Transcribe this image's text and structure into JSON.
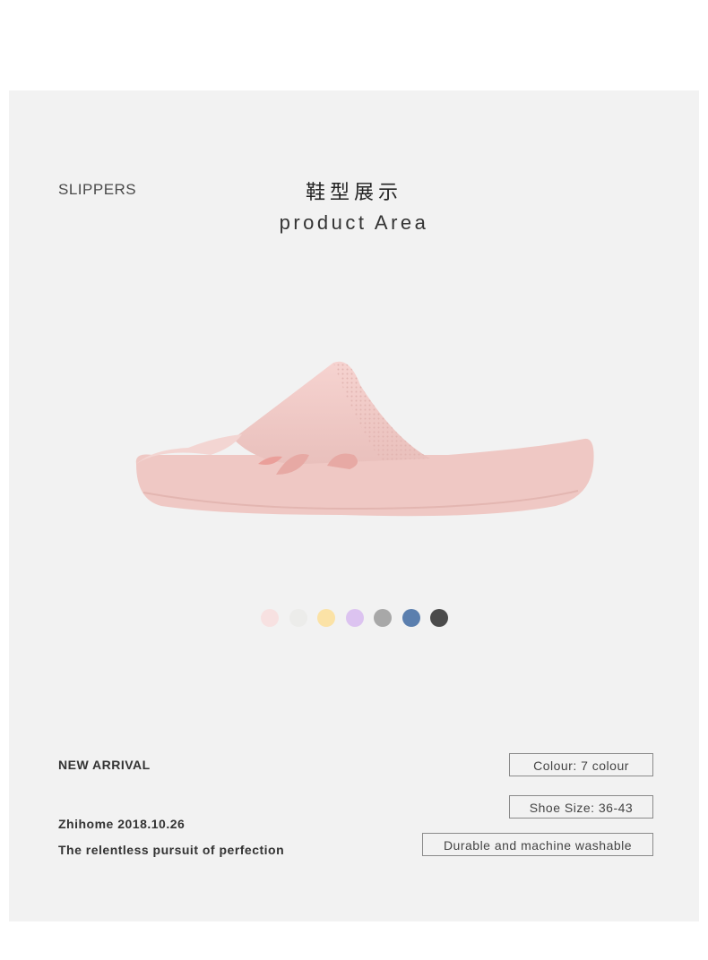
{
  "header": {
    "category": "SLIPPERS",
    "title_cn": "鞋型展示",
    "title_en": "product Area"
  },
  "product": {
    "image_label": "pink slide slipper",
    "colors": [
      "#f7e1e1",
      "#ececea",
      "#fbe2a6",
      "#dcc3f0",
      "#a8a8a8",
      "#5b7fae",
      "#4b4b4b"
    ]
  },
  "info": {
    "new_arrival": "NEW ARRIVAL",
    "brand_date": "Zhihome  2018.10.26",
    "tagline": "The relentless pursuit of perfection"
  },
  "specs": {
    "colour": "Colour: 7 colour",
    "size": "Shoe Size: 36-43",
    "care": "Durable and machine washable"
  }
}
